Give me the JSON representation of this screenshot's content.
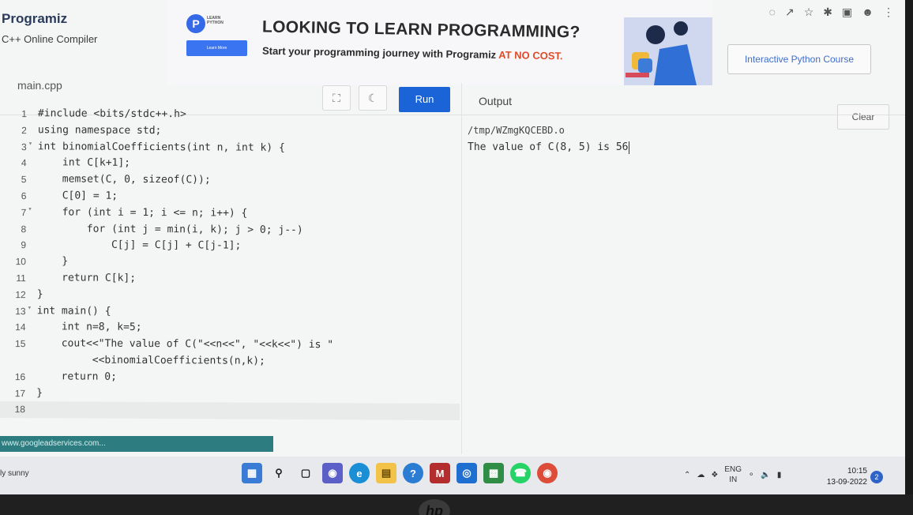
{
  "brand": {
    "title": "Programiz",
    "subtitle": "C++ Online Compiler"
  },
  "ad": {
    "logo_letter": "P",
    "logo_text": "LEARN PYTHON",
    "learn_more": "Learn More",
    "headline": "LOOKING TO LEARN PROGRAMMING?",
    "tagline_start": "Start your programming journey with Programiz ",
    "tagline_highlight": "AT NO COST.",
    "course_button": "Interactive Python Course",
    "accent_color": "#e04b2a"
  },
  "editor": {
    "file_name": "main.cpp",
    "run_label": "Run",
    "fullscreen_icon": "expand-icon",
    "theme_icon": "moon-icon"
  },
  "code_lines": [
    {
      "n": "1",
      "text": "#include <bits/stdc++.h>"
    },
    {
      "n": "2",
      "text": "using namespace std;"
    },
    {
      "n": "3",
      "text": "int binomialCoefficients(int n, int k) {",
      "fold": true
    },
    {
      "n": "4",
      "text": "    int C[k+1];"
    },
    {
      "n": "5",
      "text": "    memset(C, 0, sizeof(C));"
    },
    {
      "n": "6",
      "text": "    C[0] = 1;"
    },
    {
      "n": "7",
      "text": "    for (int i = 1; i <= n; i++) {",
      "fold": true
    },
    {
      "n": "8",
      "text": "        for (int j = min(i, k); j > 0; j--)"
    },
    {
      "n": "9",
      "text": "            C[j] = C[j] + C[j-1];"
    },
    {
      "n": "10",
      "text": "    }"
    },
    {
      "n": "11",
      "text": "    return C[k];"
    },
    {
      "n": "12",
      "text": "}"
    },
    {
      "n": "13",
      "text": "int main() {",
      "fold": true
    },
    {
      "n": "14",
      "text": "    int n=8, k=5;"
    },
    {
      "n": "15",
      "text": "    cout<<\"The value of C(\"<<n<<\", \"<<k<<\") is \""
    },
    {
      "n": "",
      "text": "         <<binomialCoefficients(n,k);"
    },
    {
      "n": "16",
      "text": "    return 0;"
    },
    {
      "n": "17",
      "text": "}"
    },
    {
      "n": "18",
      "text": ""
    }
  ],
  "output": {
    "label": "Output",
    "clear_label": "Clear",
    "path": "/tmp/WZmgKQCEBD.o",
    "result": "The value of C(8, 5) is 56"
  },
  "status_link": "www.googleadservices.com...",
  "taskbar": {
    "weather": "ly sunny",
    "lang_top": "ENG",
    "lang_bottom": "IN",
    "time": "10:15",
    "date": "13-09-2022",
    "notifications": "2"
  }
}
